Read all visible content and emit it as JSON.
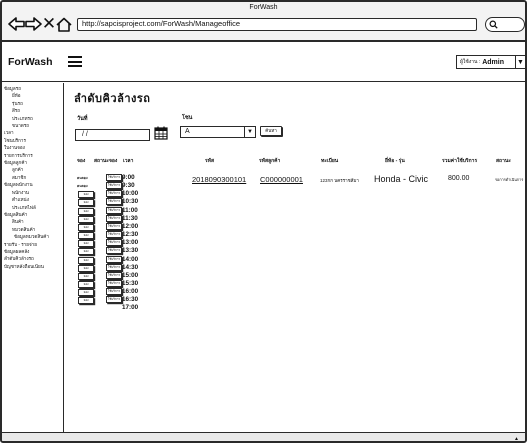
{
  "window": {
    "title": "ForWash"
  },
  "browser": {
    "url": "http://sapcisproject.com/ForWash/Manageoffice"
  },
  "header": {
    "brand": "ForWash",
    "user_label": "ผู้ใช้งาน :",
    "user_value": "Admin"
  },
  "sidebar": {
    "items": [
      {
        "label": "ข้อมูลรถ",
        "level": 1
      },
      {
        "label": "ยี่ห้อ",
        "level": 2
      },
      {
        "label": "รุ่นรถ",
        "level": 2
      },
      {
        "label": "สีรถ",
        "level": 2
      },
      {
        "label": "ประเภทรถ",
        "level": 2
      },
      {
        "label": "ขนาดรถ",
        "level": 2
      },
      {
        "label": "เวลา",
        "level": 1
      },
      {
        "label": "โซนบริการ",
        "level": 1
      },
      {
        "label": "ใบงานจอง",
        "level": 1
      },
      {
        "label": "รายการบริการ",
        "level": 1
      },
      {
        "label": "ข้อมูลลูกค้า",
        "level": 1
      },
      {
        "label": "ลูกค้า",
        "level": 2
      },
      {
        "label": "สมาชิก",
        "level": 2
      },
      {
        "label": "ข้อมูลพนักงาน",
        "level": 1
      },
      {
        "label": "พนักงาน",
        "level": 2
      },
      {
        "label": "ตำแหน่ง",
        "level": 2
      },
      {
        "label": "ประเภทไฟล์",
        "level": 2
      },
      {
        "label": "ข้อมูลสินค้า",
        "level": 1
      },
      {
        "label": "สินค้า",
        "level": 2
      },
      {
        "label": "หมวดสินค้า",
        "level": 2
      },
      {
        "label": "ข้อมูลหมวดสินค้า",
        "level": 3
      },
      {
        "label": "รายรับ - รายจ่าย",
        "level": 1
      },
      {
        "label": "ข้อมูลผลคลัง",
        "level": 1
      },
      {
        "label": "ลำดับคิวล้างรถ",
        "level": 1
      },
      {
        "label": "บัญชาหลังถือนเนียน",
        "level": 1
      }
    ]
  },
  "main": {
    "title": "ลำดับคิวล้างรถ",
    "date_label": "วันที่",
    "date_value": "/ /",
    "zone_label": "โซน",
    "zone_value": "A",
    "search_button": "ค้นหา",
    "columns": {
      "queue": "จอง",
      "queue_status": "สถานะจอง",
      "time": "เวลา",
      "code": "รหัส",
      "customer_code": "รหัสลูกค้า",
      "plate": "ทะเบียน",
      "brand_model": "ยี่ห้อ - รุ่น",
      "price": "รวมค่าใช้บริการ",
      "status": "สถานะ"
    },
    "times": [
      "9:00",
      "9:30",
      "10:00",
      "10:30",
      "11:00",
      "11:30",
      "12:00",
      "12:30",
      "13:00",
      "13:30",
      "14:00",
      "14:30",
      "15:00",
      "15:30",
      "16:00",
      "16:30",
      "17:00"
    ],
    "slot_labels": {
      "queue_text": "คนจอง",
      "queue_button": "จอง",
      "status_button": "ใช้บริการ"
    },
    "booking": {
      "code": "2018090300101",
      "customer_code": "C000000001",
      "plate": "123กก นครราชสีมา",
      "brand_model": "Honda - Civic",
      "price": "800.00",
      "status": "รอการดำเนินการ"
    }
  }
}
